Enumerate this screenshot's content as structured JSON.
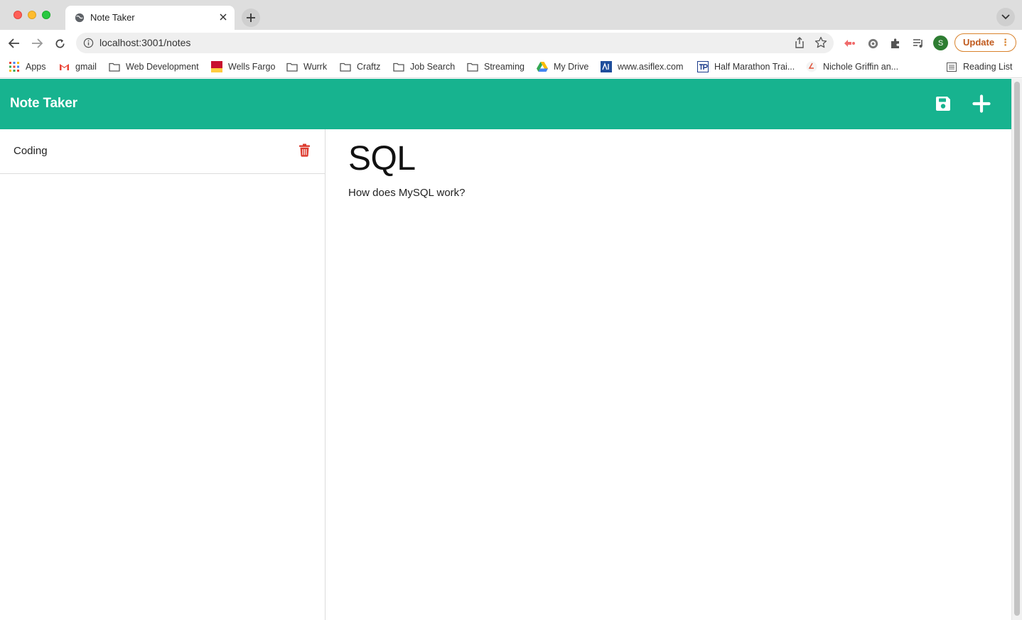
{
  "browser": {
    "tab_title": "Note Taker",
    "url": "localhost:3001/notes",
    "profile_initial": "S",
    "update_label": "Update",
    "bookmarks": [
      {
        "label": "Apps",
        "icon": "apps-grid-icon"
      },
      {
        "label": "gmail",
        "icon": "gmail-icon"
      },
      {
        "label": "Web Development",
        "icon": "folder-icon"
      },
      {
        "label": "Wells Fargo",
        "icon": "wells-fargo-icon"
      },
      {
        "label": "Wurrk",
        "icon": "folder-icon"
      },
      {
        "label": "Craftz",
        "icon": "folder-icon"
      },
      {
        "label": "Job Search",
        "icon": "folder-icon"
      },
      {
        "label": "Streaming",
        "icon": "folder-icon"
      },
      {
        "label": "My Drive",
        "icon": "google-drive-icon"
      },
      {
        "label": "www.asiflex.com",
        "icon": "asiflex-icon"
      },
      {
        "label": "Half Marathon Trai...",
        "icon": "tp-icon"
      },
      {
        "label": "Nichole Griffin an...",
        "icon": "site-icon"
      }
    ],
    "reading_list": "Reading List"
  },
  "app": {
    "brand": "Note Taker",
    "accent_color": "#17b38f",
    "delete_color": "#dd3b2f",
    "notes": [
      {
        "title": "Coding"
      }
    ],
    "active_note": {
      "title": "SQL",
      "text": "How does MySQL work?"
    }
  }
}
